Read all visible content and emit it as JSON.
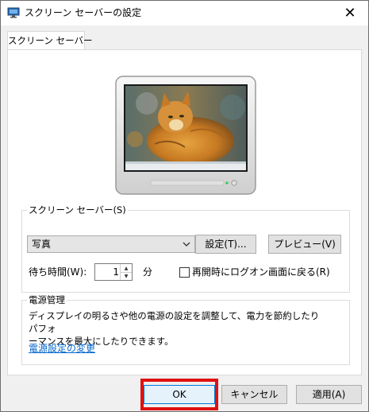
{
  "window": {
    "title": "スクリーン セーバーの設定",
    "close_symbol": "✕"
  },
  "tabs": [
    {
      "label": "スクリーン セーバー"
    }
  ],
  "preview": {
    "description_icon": "monitor-preview-cat-photo"
  },
  "screensaver": {
    "group_label": "スクリーン セーバー(S)",
    "selected": "写真",
    "settings_button": "設定(T)...",
    "preview_button": "プレビュー(V)",
    "wait_label": "待ち時間(W):",
    "wait_value": "1",
    "wait_unit": "分",
    "resume_checkbox_label": "再開時にログオン画面に戻る(R)",
    "resume_checked": false
  },
  "power": {
    "group_label": "電源管理",
    "description_line1": "ディスプレイの明るさや他の電源の設定を調整して、電力を節約したりパフォ",
    "description_line2": "ーマンスを最大にしたりできます。",
    "link": "電源設定の変更"
  },
  "footer": {
    "ok": "OK",
    "cancel": "キャンセル",
    "apply": "適用(A)"
  },
  "colors": {
    "highlight": "#e01111",
    "link": "#0066cc",
    "default_button_border": "#0078d7"
  }
}
